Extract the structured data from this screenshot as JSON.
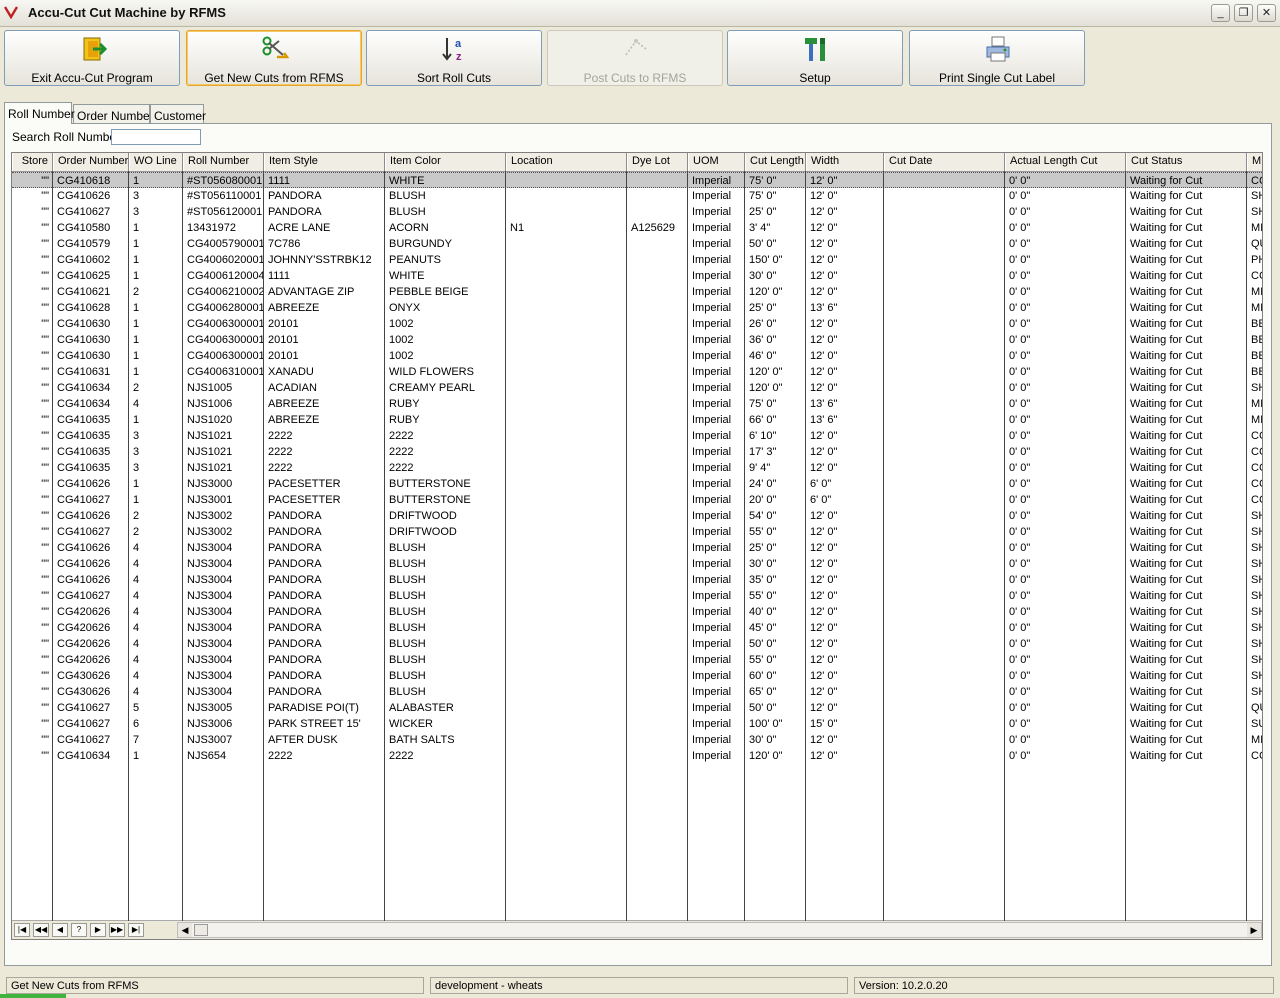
{
  "window": {
    "title": "Accu-Cut Cut Machine by RFMS"
  },
  "toolbar": {
    "buttons": [
      {
        "label": "Exit Accu-Cut Program",
        "icon": "exit-door-icon"
      },
      {
        "label": "Get New Cuts from RFMS",
        "icon": "scissors-arrow-icon"
      },
      {
        "label": "Sort Roll Cuts",
        "icon": "sort-az-icon"
      },
      {
        "label": "Post Cuts to RFMS",
        "icon": "post-cuts-icon"
      },
      {
        "label": "Setup",
        "icon": "tools-icon"
      },
      {
        "label": "Print Single Cut Label",
        "icon": "printer-icon"
      }
    ]
  },
  "tabs": [
    "Roll Number",
    "Order Number",
    "Customer"
  ],
  "search": {
    "label": "Search Roll Number",
    "value": ""
  },
  "grid": {
    "columns": [
      "Store",
      "Order Number",
      "WO Line",
      "Roll Number",
      "Item Style",
      "Item Color",
      "Location",
      "Dye Lot",
      "UOM",
      "Cut Length",
      "Width",
      "Cut Date",
      "Actual Length Cut",
      "Cut Status",
      "M"
    ],
    "rows": [
      [
        "\"\"",
        "CG410618",
        "1",
        "#ST056080001",
        "1111",
        "WHITE",
        "",
        "",
        "Imperial",
        "75' 0\"",
        "12' 0\"",
        "",
        "0' 0\"",
        "Waiting for Cut",
        "CC"
      ],
      [
        "\"\"",
        "CG410626",
        "3",
        "#ST056110001",
        "PANDORA",
        "BLUSH",
        "",
        "",
        "Imperial",
        "75' 0\"",
        "12' 0\"",
        "",
        "0' 0\"",
        "Waiting for Cut",
        "SH"
      ],
      [
        "\"\"",
        "CG410627",
        "3",
        "#ST056120001",
        "PANDORA",
        "BLUSH",
        "",
        "",
        "Imperial",
        "25' 0\"",
        "12' 0\"",
        "",
        "0' 0\"",
        "Waiting for Cut",
        "SH"
      ],
      [
        "\"\"",
        "CG410580",
        "1",
        "13431972",
        "ACRE LANE",
        "ACORN",
        "N1",
        "A125629",
        "Imperial",
        "3' 4\"",
        "12' 0\"",
        "",
        "0' 0\"",
        "Waiting for Cut",
        "MI"
      ],
      [
        "\"\"",
        "CG410579",
        "1",
        "CG4005790001",
        "7C786",
        "BURGUNDY",
        "",
        "",
        "Imperial",
        "50' 0\"",
        "12' 0\"",
        "",
        "0' 0\"",
        "Waiting for Cut",
        "QU"
      ],
      [
        "\"\"",
        "CG410602",
        "1",
        "CG4006020001",
        "JOHNNY'SSTRBK12",
        "PEANUTS",
        "",
        "",
        "Imperial",
        "150' 0\"",
        "12' 0\"",
        "",
        "0' 0\"",
        "Waiting for Cut",
        "PH"
      ],
      [
        "\"\"",
        "CG410625",
        "1",
        "CG4006120004",
        "1111",
        "WHITE",
        "",
        "",
        "Imperial",
        "30' 0\"",
        "12' 0\"",
        "",
        "0' 0\"",
        "Waiting for Cut",
        "CC"
      ],
      [
        "\"\"",
        "CG410621",
        "2",
        "CG4006210002",
        "ADVANTAGE ZIP",
        "PEBBLE BEIGE",
        "",
        "",
        "Imperial",
        "120' 0\"",
        "12' 0\"",
        "",
        "0' 0\"",
        "Waiting for Cut",
        "MI"
      ],
      [
        "\"\"",
        "CG410628",
        "1",
        "CG4006280001",
        "ABREEZE",
        "ONYX",
        "",
        "",
        "Imperial",
        "25' 0\"",
        "13' 6\"",
        "",
        "0' 0\"",
        "Waiting for Cut",
        "MI"
      ],
      [
        "\"\"",
        "CG410630",
        "1",
        "CG4006300001",
        "20101",
        "1002",
        "",
        "",
        "Imperial",
        "26' 0\"",
        "12' 0\"",
        "",
        "0' 0\"",
        "Waiting for Cut",
        "BE"
      ],
      [
        "\"\"",
        "CG410630",
        "1",
        "CG4006300001",
        "20101",
        "1002",
        "",
        "",
        "Imperial",
        "36' 0\"",
        "12' 0\"",
        "",
        "0' 0\"",
        "Waiting for Cut",
        "BE"
      ],
      [
        "\"\"",
        "CG410630",
        "1",
        "CG4006300001",
        "20101",
        "1002",
        "",
        "",
        "Imperial",
        "46' 0\"",
        "12' 0\"",
        "",
        "0' 0\"",
        "Waiting for Cut",
        "BE"
      ],
      [
        "\"\"",
        "CG410631",
        "1",
        "CG4006310001",
        "XANADU",
        "WILD FLOWERS",
        "",
        "",
        "Imperial",
        "120' 0\"",
        "12' 0\"",
        "",
        "0' 0\"",
        "Waiting for Cut",
        "BE"
      ],
      [
        "\"\"",
        "CG410634",
        "2",
        "NJS1005",
        "ACADIAN",
        "CREAMY PEARL",
        "",
        "",
        "Imperial",
        "120' 0\"",
        "12' 0\"",
        "",
        "0' 0\"",
        "Waiting for Cut",
        "SH"
      ],
      [
        "\"\"",
        "CG410634",
        "4",
        "NJS1006",
        "ABREEZE",
        "RUBY",
        "",
        "",
        "Imperial",
        "75' 0\"",
        "13' 6\"",
        "",
        "0' 0\"",
        "Waiting for Cut",
        "MI"
      ],
      [
        "\"\"",
        "CG410635",
        "1",
        "NJS1020",
        "ABREEZE",
        "RUBY",
        "",
        "",
        "Imperial",
        "66' 0\"",
        "13' 6\"",
        "",
        "0' 0\"",
        "Waiting for Cut",
        "MI"
      ],
      [
        "\"\"",
        "CG410635",
        "3",
        "NJS1021",
        "2222",
        "2222",
        "",
        "",
        "Imperial",
        "6' 10\"",
        "12' 0\"",
        "",
        "0' 0\"",
        "Waiting for Cut",
        "CC"
      ],
      [
        "\"\"",
        "CG410635",
        "3",
        "NJS1021",
        "2222",
        "2222",
        "",
        "",
        "Imperial",
        "17' 3\"",
        "12' 0\"",
        "",
        "0' 0\"",
        "Waiting for Cut",
        "CC"
      ],
      [
        "\"\"",
        "CG410635",
        "3",
        "NJS1021",
        "2222",
        "2222",
        "",
        "",
        "Imperial",
        "9' 4\"",
        "12' 0\"",
        "",
        "0' 0\"",
        "Waiting for Cut",
        "CC"
      ],
      [
        "\"\"",
        "CG410626",
        "1",
        "NJS3000",
        "PACESETTER",
        "BUTTERSTONE",
        "",
        "",
        "Imperial",
        "24' 0\"",
        "6' 0\"",
        "",
        "0' 0\"",
        "Waiting for Cut",
        "CC"
      ],
      [
        "\"\"",
        "CG410627",
        "1",
        "NJS3001",
        "PACESETTER",
        "BUTTERSTONE",
        "",
        "",
        "Imperial",
        "20' 0\"",
        "6' 0\"",
        "",
        "0' 0\"",
        "Waiting for Cut",
        "CC"
      ],
      [
        "\"\"",
        "CG410626",
        "2",
        "NJS3002",
        "PANDORA",
        "DRIFTWOOD",
        "",
        "",
        "Imperial",
        "54' 0\"",
        "12' 0\"",
        "",
        "0' 0\"",
        "Waiting for Cut",
        "SH"
      ],
      [
        "\"\"",
        "CG410627",
        "2",
        "NJS3002",
        "PANDORA",
        "DRIFTWOOD",
        "",
        "",
        "Imperial",
        "55' 0\"",
        "12' 0\"",
        "",
        "0' 0\"",
        "Waiting for Cut",
        "SH"
      ],
      [
        "\"\"",
        "CG410626",
        "4",
        "NJS3004",
        "PANDORA",
        "BLUSH",
        "",
        "",
        "Imperial",
        "25' 0\"",
        "12' 0\"",
        "",
        "0' 0\"",
        "Waiting for Cut",
        "SH"
      ],
      [
        "\"\"",
        "CG410626",
        "4",
        "NJS3004",
        "PANDORA",
        "BLUSH",
        "",
        "",
        "Imperial",
        "30' 0\"",
        "12' 0\"",
        "",
        "0' 0\"",
        "Waiting for Cut",
        "SH"
      ],
      [
        "\"\"",
        "CG410626",
        "4",
        "NJS3004",
        "PANDORA",
        "BLUSH",
        "",
        "",
        "Imperial",
        "35' 0\"",
        "12' 0\"",
        "",
        "0' 0\"",
        "Waiting for Cut",
        "SH"
      ],
      [
        "\"\"",
        "CG410627",
        "4",
        "NJS3004",
        "PANDORA",
        "BLUSH",
        "",
        "",
        "Imperial",
        "55' 0\"",
        "12' 0\"",
        "",
        "0' 0\"",
        "Waiting for Cut",
        "SH"
      ],
      [
        "\"\"",
        "CG420626",
        "4",
        "NJS3004",
        "PANDORA",
        "BLUSH",
        "",
        "",
        "Imperial",
        "40' 0\"",
        "12' 0\"",
        "",
        "0' 0\"",
        "Waiting for Cut",
        "SH"
      ],
      [
        "\"\"",
        "CG420626",
        "4",
        "NJS3004",
        "PANDORA",
        "BLUSH",
        "",
        "",
        "Imperial",
        "45' 0\"",
        "12' 0\"",
        "",
        "0' 0\"",
        "Waiting for Cut",
        "SH"
      ],
      [
        "\"\"",
        "CG420626",
        "4",
        "NJS3004",
        "PANDORA",
        "BLUSH",
        "",
        "",
        "Imperial",
        "50' 0\"",
        "12' 0\"",
        "",
        "0' 0\"",
        "Waiting for Cut",
        "SH"
      ],
      [
        "\"\"",
        "CG420626",
        "4",
        "NJS3004",
        "PANDORA",
        "BLUSH",
        "",
        "",
        "Imperial",
        "55' 0\"",
        "12' 0\"",
        "",
        "0' 0\"",
        "Waiting for Cut",
        "SH"
      ],
      [
        "\"\"",
        "CG430626",
        "4",
        "NJS3004",
        "PANDORA",
        "BLUSH",
        "",
        "",
        "Imperial",
        "60' 0\"",
        "12' 0\"",
        "",
        "0' 0\"",
        "Waiting for Cut",
        "SH"
      ],
      [
        "\"\"",
        "CG430626",
        "4",
        "NJS3004",
        "PANDORA",
        "BLUSH",
        "",
        "",
        "Imperial",
        "65' 0\"",
        "12' 0\"",
        "",
        "0' 0\"",
        "Waiting for Cut",
        "SH"
      ],
      [
        "\"\"",
        "CG410627",
        "5",
        "NJS3005",
        "PARADISE POI(T)",
        "ALABASTER",
        "",
        "",
        "Imperial",
        "50' 0\"",
        "12' 0\"",
        "",
        "0' 0\"",
        "Waiting for Cut",
        "QU"
      ],
      [
        "\"\"",
        "CG410627",
        "6",
        "NJS3006",
        "PARK STREET 15'",
        "WICKER",
        "",
        "",
        "Imperial",
        "100' 0\"",
        "15' 0\"",
        "",
        "0' 0\"",
        "Waiting for Cut",
        "SU"
      ],
      [
        "\"\"",
        "CG410627",
        "7",
        "NJS3007",
        "AFTER DUSK",
        "BATH SALTS",
        "",
        "",
        "Imperial",
        "30' 0\"",
        "12' 0\"",
        "",
        "0' 0\"",
        "Waiting for Cut",
        "MI"
      ],
      [
        "\"\"",
        "CG410634",
        "1",
        "NJS654",
        "2222",
        "2222",
        "",
        "",
        "Imperial",
        "120' 0\"",
        "12' 0\"",
        "",
        "0' 0\"",
        "Waiting for Cut",
        "CC"
      ]
    ],
    "selected_row": 0
  },
  "navigator": {
    "buttons": [
      {
        "glyph": "|◀",
        "icon": "first-record-icon"
      },
      {
        "glyph": "◀◀",
        "icon": "prev-page-icon"
      },
      {
        "glyph": "◀",
        "icon": "prev-record-icon"
      },
      {
        "glyph": "?",
        "icon": "help-icon"
      },
      {
        "glyph": "▶",
        "icon": "next-record-icon"
      },
      {
        "glyph": "▶▶",
        "icon": "next-page-icon"
      },
      {
        "glyph": "▶|",
        "icon": "last-record-icon"
      }
    ]
  },
  "status": {
    "left": "Get New Cuts from RFMS",
    "middle": "development - wheats",
    "right": "Version: 10.2.0.20"
  },
  "colors": {
    "accent": "#e5a52f",
    "selection": "#c9c9c9",
    "chrome": "#ECE9D8"
  }
}
